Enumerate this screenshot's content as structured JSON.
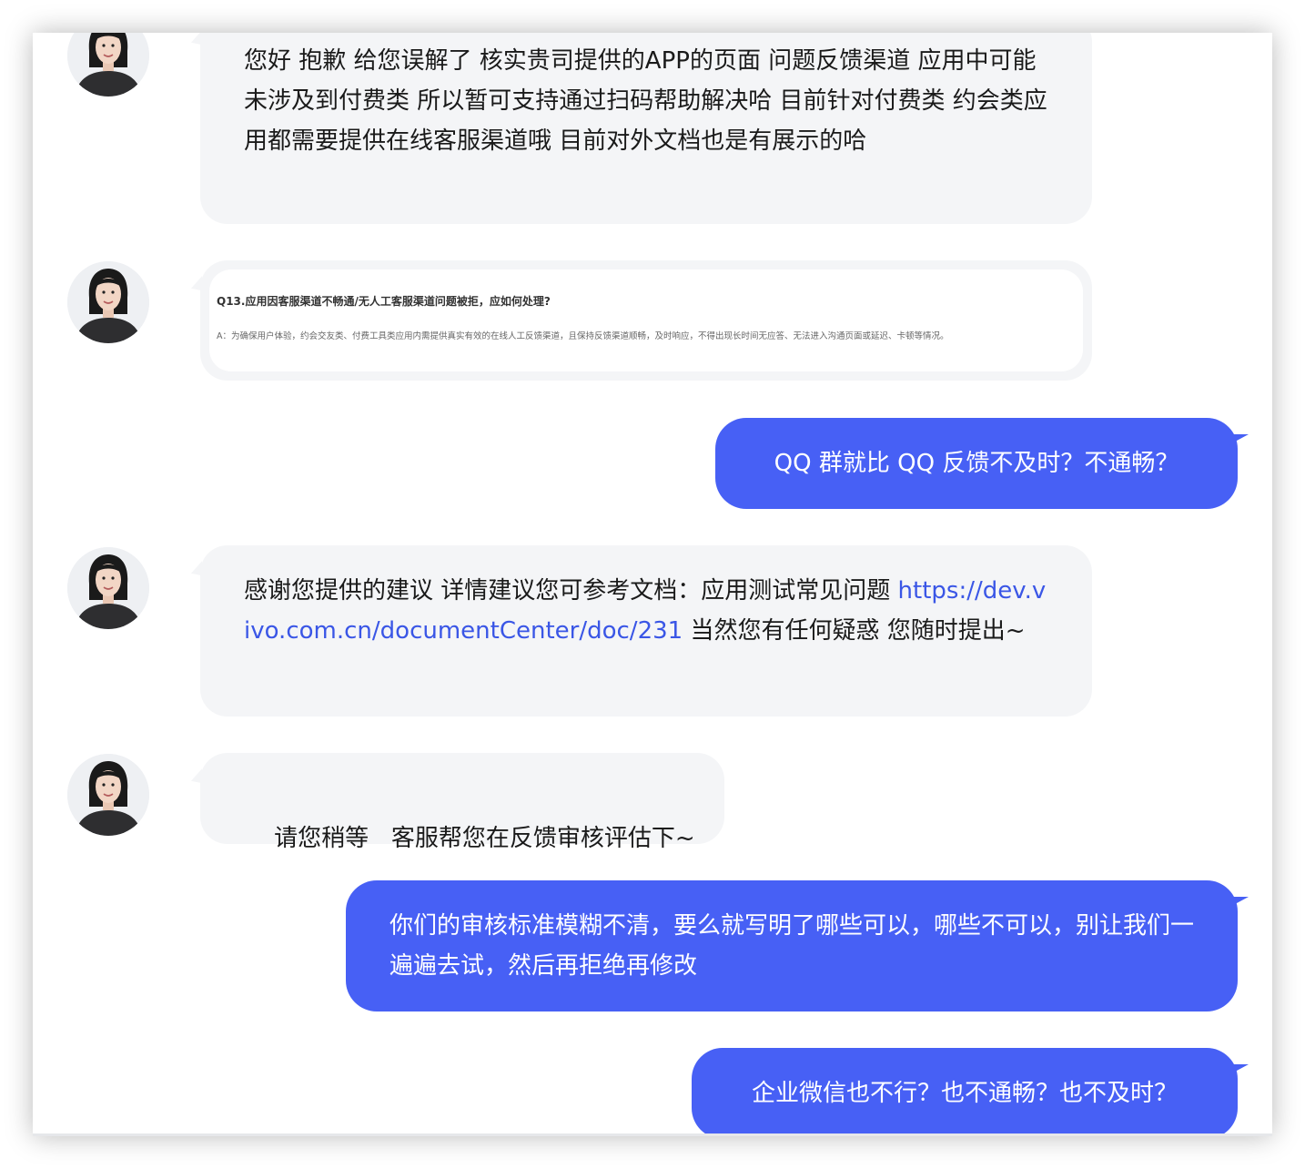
{
  "messages": [
    {
      "id": "m1",
      "side": "agent",
      "text": "您好 抱歉 给您误解了 核实贵司提供的APP的页面 问题反馈渠道 应用中可能未涉及到付费类 所以暂可支持通过扫码帮助解决哈   目前针对付费类 约会类应用都需要提供在线客服渠道哦 目前对外文档也是有展示的哈"
    },
    {
      "id": "m2",
      "side": "agent",
      "type": "image",
      "doc_question": "Q13.应用因客服渠道不畅通/无人工客服渠道问题被拒，应如何处理?",
      "doc_answer": "A：为确保用户体验，约会交友类、付费工具类应用内需提供真实有效的在线人工反馈渠道，且保持反馈渠道顺畅，及时响应，不得出现长时间无应答、无法进入沟通页面或延迟、卡顿等情况。"
    },
    {
      "id": "m3",
      "side": "user",
      "text": "QQ 群就比 QQ 反馈不及时？不通畅？"
    },
    {
      "id": "m4",
      "side": "agent",
      "text_before": "感谢您提供的建议 详情建议您可参考文档：应用测试常见问题 ",
      "link": "https://dev.vivo.com.cn/documentCenter/doc/231",
      "text_after": " 当然您有任何疑惑 您随时提出~"
    },
    {
      "id": "m5",
      "side": "agent",
      "text": "请您稍等   客服帮您在反馈审核评估下~"
    },
    {
      "id": "m6",
      "side": "user",
      "text": "你们的审核标准模糊不清，要么就写明了哪些可以，哪些不可以，别让我们一遍遍去试，然后再拒绝再修改"
    },
    {
      "id": "m7",
      "side": "user",
      "text": "企业微信也不行？也不通畅？也不及时？"
    }
  ],
  "colors": {
    "agent_bubble": "#f4f5f7",
    "user_bubble": "#4760f5",
    "link": "#3a56e6"
  }
}
